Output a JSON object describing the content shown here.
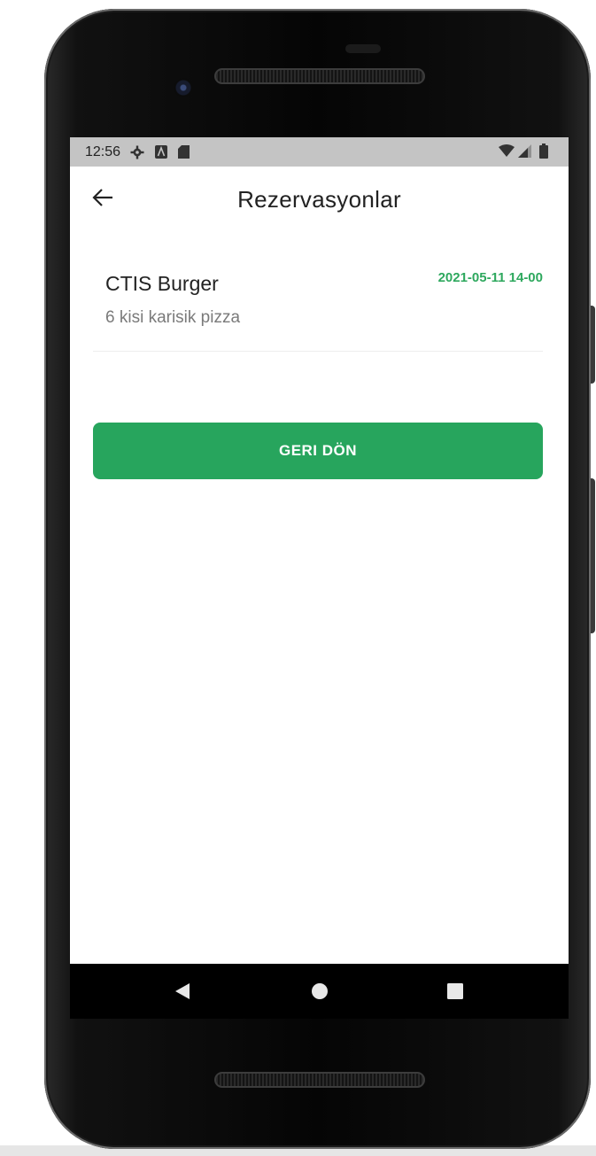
{
  "status_bar": {
    "time": "12:56",
    "left_icons": [
      "settings-icon",
      "notification-a-icon",
      "sd-card-icon"
    ],
    "right_icons": [
      "wifi-icon",
      "signal-icon",
      "battery-icon"
    ]
  },
  "app_bar": {
    "title": "Rezervasyonlar",
    "back_icon": "arrow-left-icon"
  },
  "reservations": [
    {
      "name": "CTIS Burger",
      "description": "6 kisi karisik pizza",
      "datetime": "2021-05-11 14-00"
    }
  ],
  "actions": {
    "back_label": "GERI DÖN"
  },
  "nav": {
    "back": "triangle-back-icon",
    "home": "circle-home-icon",
    "recents": "square-recents-icon"
  },
  "colors": {
    "accent": "#27a55d",
    "date_text": "#2ea85e",
    "status_bar": "#c4c4c4"
  }
}
